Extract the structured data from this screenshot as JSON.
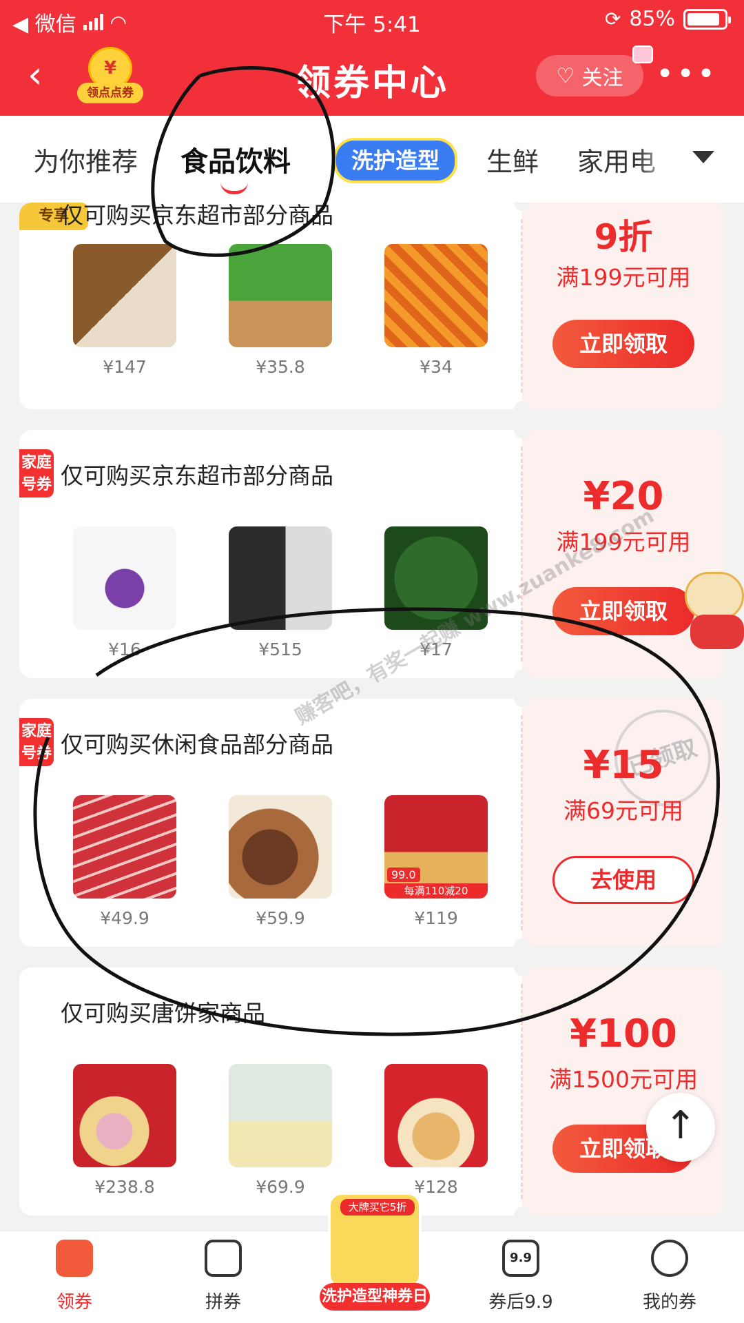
{
  "status_bar": {
    "carrier": "◀ 微信",
    "time": "下午 5:41",
    "battery": "85%"
  },
  "header": {
    "back_glyph": "‹",
    "coin_symbol": "¥",
    "coin_label": "领点点券",
    "title": "领券中心",
    "follow_label": "关注",
    "more_glyph": "•••"
  },
  "tabs": [
    {
      "label": "为你推荐",
      "active": false
    },
    {
      "label": "食品饮料",
      "active": true
    },
    {
      "label": "洗护造型",
      "active": false,
      "promo": true
    },
    {
      "label": "生鲜",
      "active": false
    },
    {
      "label": "家用电",
      "active": false
    }
  ],
  "coupons": [
    {
      "badge": "专享",
      "title": "仅可购买京东超市部分商品",
      "products": [
        {
          "price": "¥147"
        },
        {
          "price": "¥35.8"
        },
        {
          "price": "¥34"
        }
      ],
      "discount": "9折",
      "condition": "满199元可用",
      "action": "立即领取"
    },
    {
      "badge": "家庭号券",
      "title": "仅可购买京东超市部分商品",
      "products": [
        {
          "price": "¥16"
        },
        {
          "price": "¥515"
        },
        {
          "price": "¥17"
        }
      ],
      "discount": "¥20",
      "condition": "满199元可用",
      "action": "立即领取"
    },
    {
      "badge": "家庭号券",
      "title": "仅可购买休闲食品部分商品",
      "products": [
        {
          "price": "¥49.9"
        },
        {
          "price": "¥59.9"
        },
        {
          "price": "¥119",
          "tag_price": "99.0",
          "tag_text": "每满110减20"
        }
      ],
      "discount": "¥15",
      "condition": "满69元可用",
      "action": "去使用",
      "stamp": "已领取"
    },
    {
      "badge": "",
      "title": "仅可购买唐饼家商品",
      "products": [
        {
          "price": "¥238.8"
        },
        {
          "price": "¥69.9"
        },
        {
          "price": "¥128"
        }
      ],
      "discount": "¥100",
      "condition": "满1500元可用",
      "action": "立即领取"
    }
  ],
  "watermark": "赚客吧，有奖一起赚 www.zuanke8.com",
  "back_to_top": "↑",
  "bottom_nav": [
    {
      "label": "领券",
      "active": true
    },
    {
      "label": "拼券",
      "active": false
    },
    {
      "label": "洗护造型神券日",
      "active": false,
      "promo": true,
      "promo_top": "大牌买它5折"
    },
    {
      "label": "券后9.9",
      "active": false,
      "icon_text": "9.9"
    },
    {
      "label": "我的券",
      "active": false
    }
  ],
  "colors": {
    "brand_red": "#f2303a",
    "coupon_red": "#ec2c2c",
    "coupon_panel": "#fdf1ef"
  }
}
